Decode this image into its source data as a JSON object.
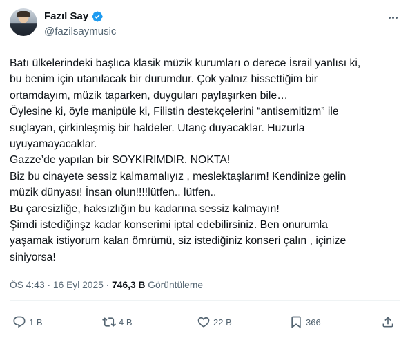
{
  "author": {
    "display_name": "Fazıl Say",
    "handle": "@fazilsaymusic",
    "verified": true
  },
  "tweet": {
    "lines": [
      "Batı ülkelerindeki başlıca klasik müzik kurumları o derece İsrail yanlısı ki,",
      "bu benim için utanılacak bir durumdur. Çok yalnız hissettiğim bir",
      "ortamdayım, müzik taparken, duyguları paylaşırken bile…",
      "Öylesine ki, öyle manipüle ki, Filistin destekçelerini “antisemitizm” ile",
      "suçlayan, çirkinleşmiş bir haldeler. Utanç duyacaklar. Huzurla",
      "uyuyamayacaklar.",
      "Gazze’de yapılan bir SOYKIRIMDIR. NOKTA!",
      "Biz bu cinayete sessiz kalmamalıyız , meslektaşlarım! Kendinize gelin",
      "müzik dünyası! İnsan olun!!!!lütfen.. lütfen..",
      "Bu çaresizliğe, haksızlığın bu kadarına sessiz kalmayın!",
      "Şimdi istediğinşz kadar konserimi iptal edebilirsiniz. Ben onurumla",
      "yaşamak istiyorum kalan ömrümü, siz istediğiniz konseri çalın , içinize",
      "siniyorsa!"
    ]
  },
  "meta": {
    "time": "ÖS 4:43",
    "separator": "·",
    "date": "16 Eyl 2025",
    "views_count": "746,3 B",
    "views_label": "Görüntüleme"
  },
  "actions": {
    "reply_count": "1 B",
    "retweet_count": "4 B",
    "like_count": "22 B",
    "bookmark_count": "366"
  },
  "icons": {
    "verified": "verified-badge-icon",
    "more": "more-dots-icon",
    "reply": "reply-icon",
    "retweet": "retweet-icon",
    "like": "heart-icon",
    "bookmark": "bookmark-icon",
    "share": "share-icon"
  },
  "colors": {
    "verified_blue": "#1d9bf0",
    "secondary_text": "#536471",
    "primary_text": "#0f1419"
  }
}
